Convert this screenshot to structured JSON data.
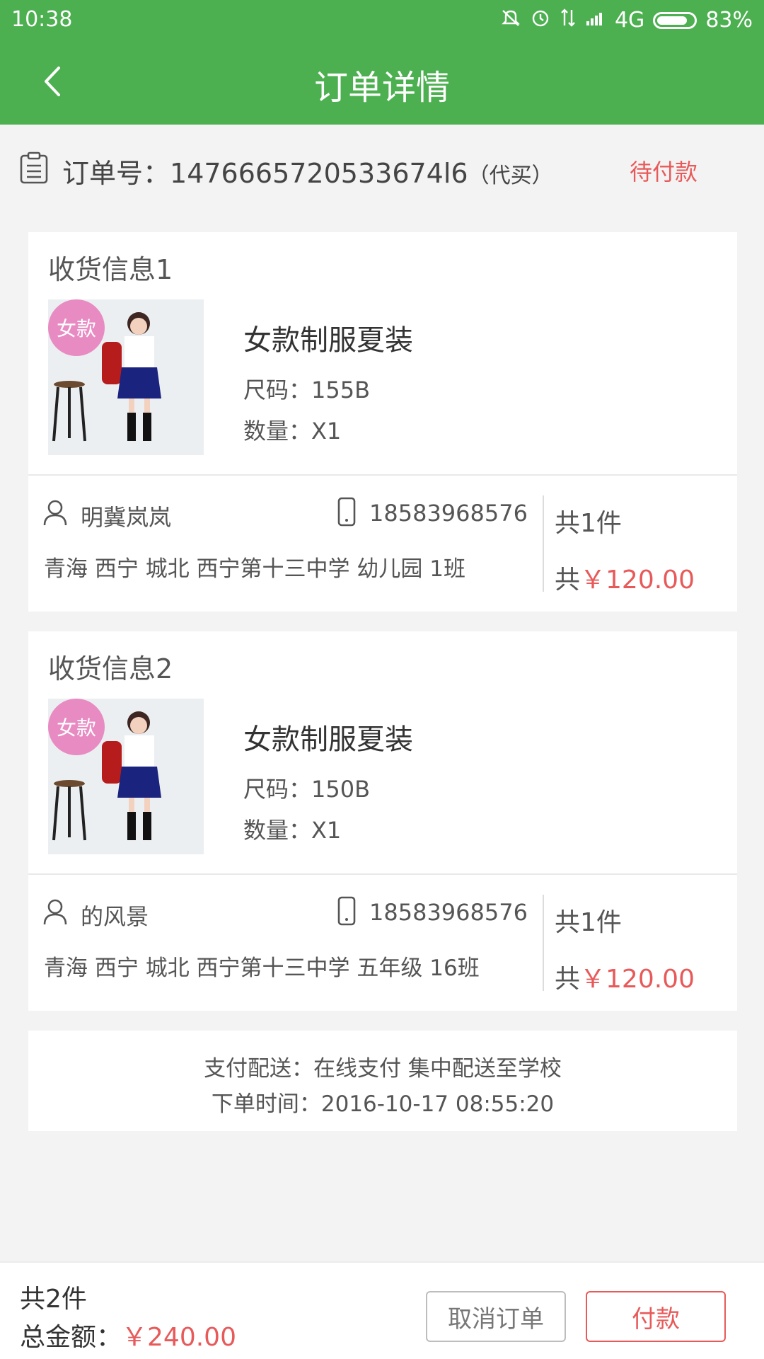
{
  "status_bar": {
    "time": "10:38",
    "network": "4G",
    "battery": "83%",
    "battery_level": 0.83,
    "icons": [
      "mute-icon",
      "alarm-icon",
      "data-transfer-icon",
      "signal-icon",
      "battery-icon"
    ]
  },
  "nav": {
    "title": "订单详情",
    "back_icon": "back-arrow-icon"
  },
  "order": {
    "label": "订单号：",
    "number": "1476665720533674l6",
    "proxy": "（代买）",
    "status": "待付款"
  },
  "shipments": [
    {
      "title": "收货信息1",
      "tag": "女款",
      "product_name": "女款制服夏装",
      "size": "尺码：155B",
      "qty": "数量：X1",
      "recipient": "明冀岚岚",
      "phone": "18583968576",
      "address": "青海 西宁 城北 西宁第十三中学 幼儿园 1班",
      "count": "共1件",
      "total_prefix": "共",
      "total_amount": "￥120.00"
    },
    {
      "title": "收货信息2",
      "tag": "女款",
      "product_name": "女款制服夏装",
      "size": "尺码：150B",
      "qty": "数量：X1",
      "recipient": "的风景",
      "phone": "18583968576",
      "address": "青海 西宁 城北 西宁第十三中学 五年级 16班",
      "count": "共1件",
      "total_prefix": "共",
      "total_amount": "￥120.00"
    }
  ],
  "info": {
    "payment": "支付配送：在线支付 集中配送至学校",
    "order_time": "下单时间：2016-10-17 08:55:20"
  },
  "bottom": {
    "count": "共2件",
    "total_label": "总金额：",
    "total_amount": "￥240.00",
    "cancel": "取消订单",
    "pay": "付款"
  },
  "colors": {
    "brand": "#4caf50",
    "accent": "#e85a5a",
    "tag": "#e88bc2"
  }
}
